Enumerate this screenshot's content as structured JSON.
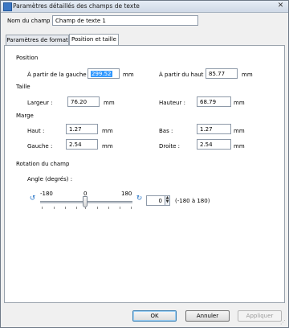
{
  "window": {
    "title": "Paramètres détaillés des champs de texte"
  },
  "name_field": {
    "label": "Nom du champ :",
    "value": "Champ de texte 1"
  },
  "tabs": [
    {
      "label": "Paramètres de format"
    },
    {
      "label": "Position et taille"
    }
  ],
  "position": {
    "heading": "Position",
    "left": {
      "label": "À partir de la gauche :",
      "value": "299.52",
      "unit": "mm"
    },
    "top": {
      "label": "À partir du haut :",
      "value": "85.77",
      "unit": "mm"
    }
  },
  "size": {
    "heading": "Taille",
    "width": {
      "label": "Largeur :",
      "value": "76.20",
      "unit": "mm"
    },
    "height": {
      "label": "Hauteur :",
      "value": "68.79",
      "unit": "mm"
    }
  },
  "margin": {
    "heading": "Marge",
    "top": {
      "label": "Haut :",
      "value": "1.27",
      "unit": "mm"
    },
    "bottom": {
      "label": "Bas :",
      "value": "1.27",
      "unit": "mm"
    },
    "left": {
      "label": "Gauche :",
      "value": "2.54",
      "unit": "mm"
    },
    "right": {
      "label": "Droite :",
      "value": "2.54",
      "unit": "mm"
    }
  },
  "rotation": {
    "heading": "Rotation du champ",
    "angle_label": "Angle (degrés) :",
    "min_label": "-180",
    "mid_label": "0",
    "max_label": "180",
    "value": "0",
    "range_hint": "(-180 à 180)"
  },
  "buttons": {
    "ok": "OK",
    "cancel": "Annuler",
    "apply": "Appliquer"
  }
}
